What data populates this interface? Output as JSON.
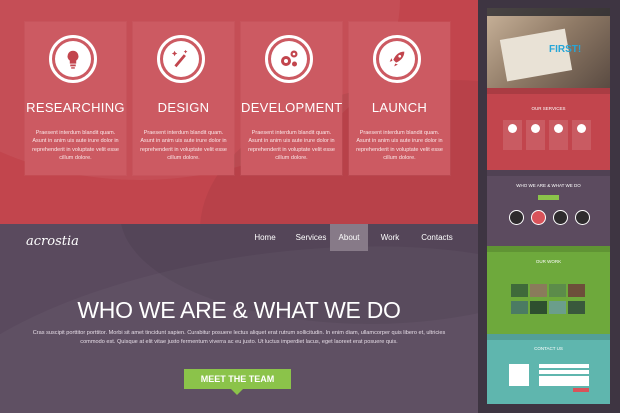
{
  "services": [
    {
      "title": "RESEARCHING",
      "icon": "lightbulb-icon",
      "desc": "Praesent interdum blandit quam. Asunt in anim uis aute irure dolor in reprehenderit in voluptate velit esse cillum dolore."
    },
    {
      "title": "DESIGN",
      "icon": "magic-wand-icon",
      "desc": "Praesent interdum blandit quam. Asunt in anim uis aute irure dolor in reprehenderit in voluptate velit esse cillum dolore."
    },
    {
      "title": "DEVELOPMENT",
      "icon": "gears-icon",
      "desc": "Praesent interdum blandit quam. Asunt in anim uis aute irure dolor in reprehenderit in voluptate velit esse cillum dolore."
    },
    {
      "title": "LAUNCH",
      "icon": "rocket-icon",
      "desc": "Praesent interdum blandit quam. Asunt in anim uis aute irure dolor in reprehenderit in voluptate velit esse cillum dolore."
    }
  ],
  "header": {
    "logo": "acrostia",
    "nav": [
      "Home",
      "Services",
      "About",
      "Work",
      "Contacts"
    ],
    "active": "About"
  },
  "about": {
    "heading": "WHO WE ARE & WHAT WE DO",
    "paragraph": "Cras suscipit porttitor porttitor. Morbi sit amet tincidunt sapien. Curabitur posuere lectus aliquet erat rutrum sollicitudin. In enim diam, ullamcorper quis libero et, ultricies commodo est. Quisque at elit vitae justo fermentum viverra ac eu justo. Ut luctus imperdiet lacus, eget laoreet erat posuere quis.",
    "cta": "MEET THE TEAM"
  },
  "preview": {
    "hero_word": "FIRST!",
    "services_title": "OUR SERVICES",
    "about_title": "WHO WE ARE & WHAT WE DO",
    "work_title": "OUR WORK",
    "contact_title": "CONTACT US"
  },
  "colors": {
    "services_bg": "#c2454d",
    "about_bg": "#5a4a5e",
    "accent_green": "#8bc34a",
    "work_bg": "#6ea93c",
    "contact_bg": "#5fb6ae"
  }
}
